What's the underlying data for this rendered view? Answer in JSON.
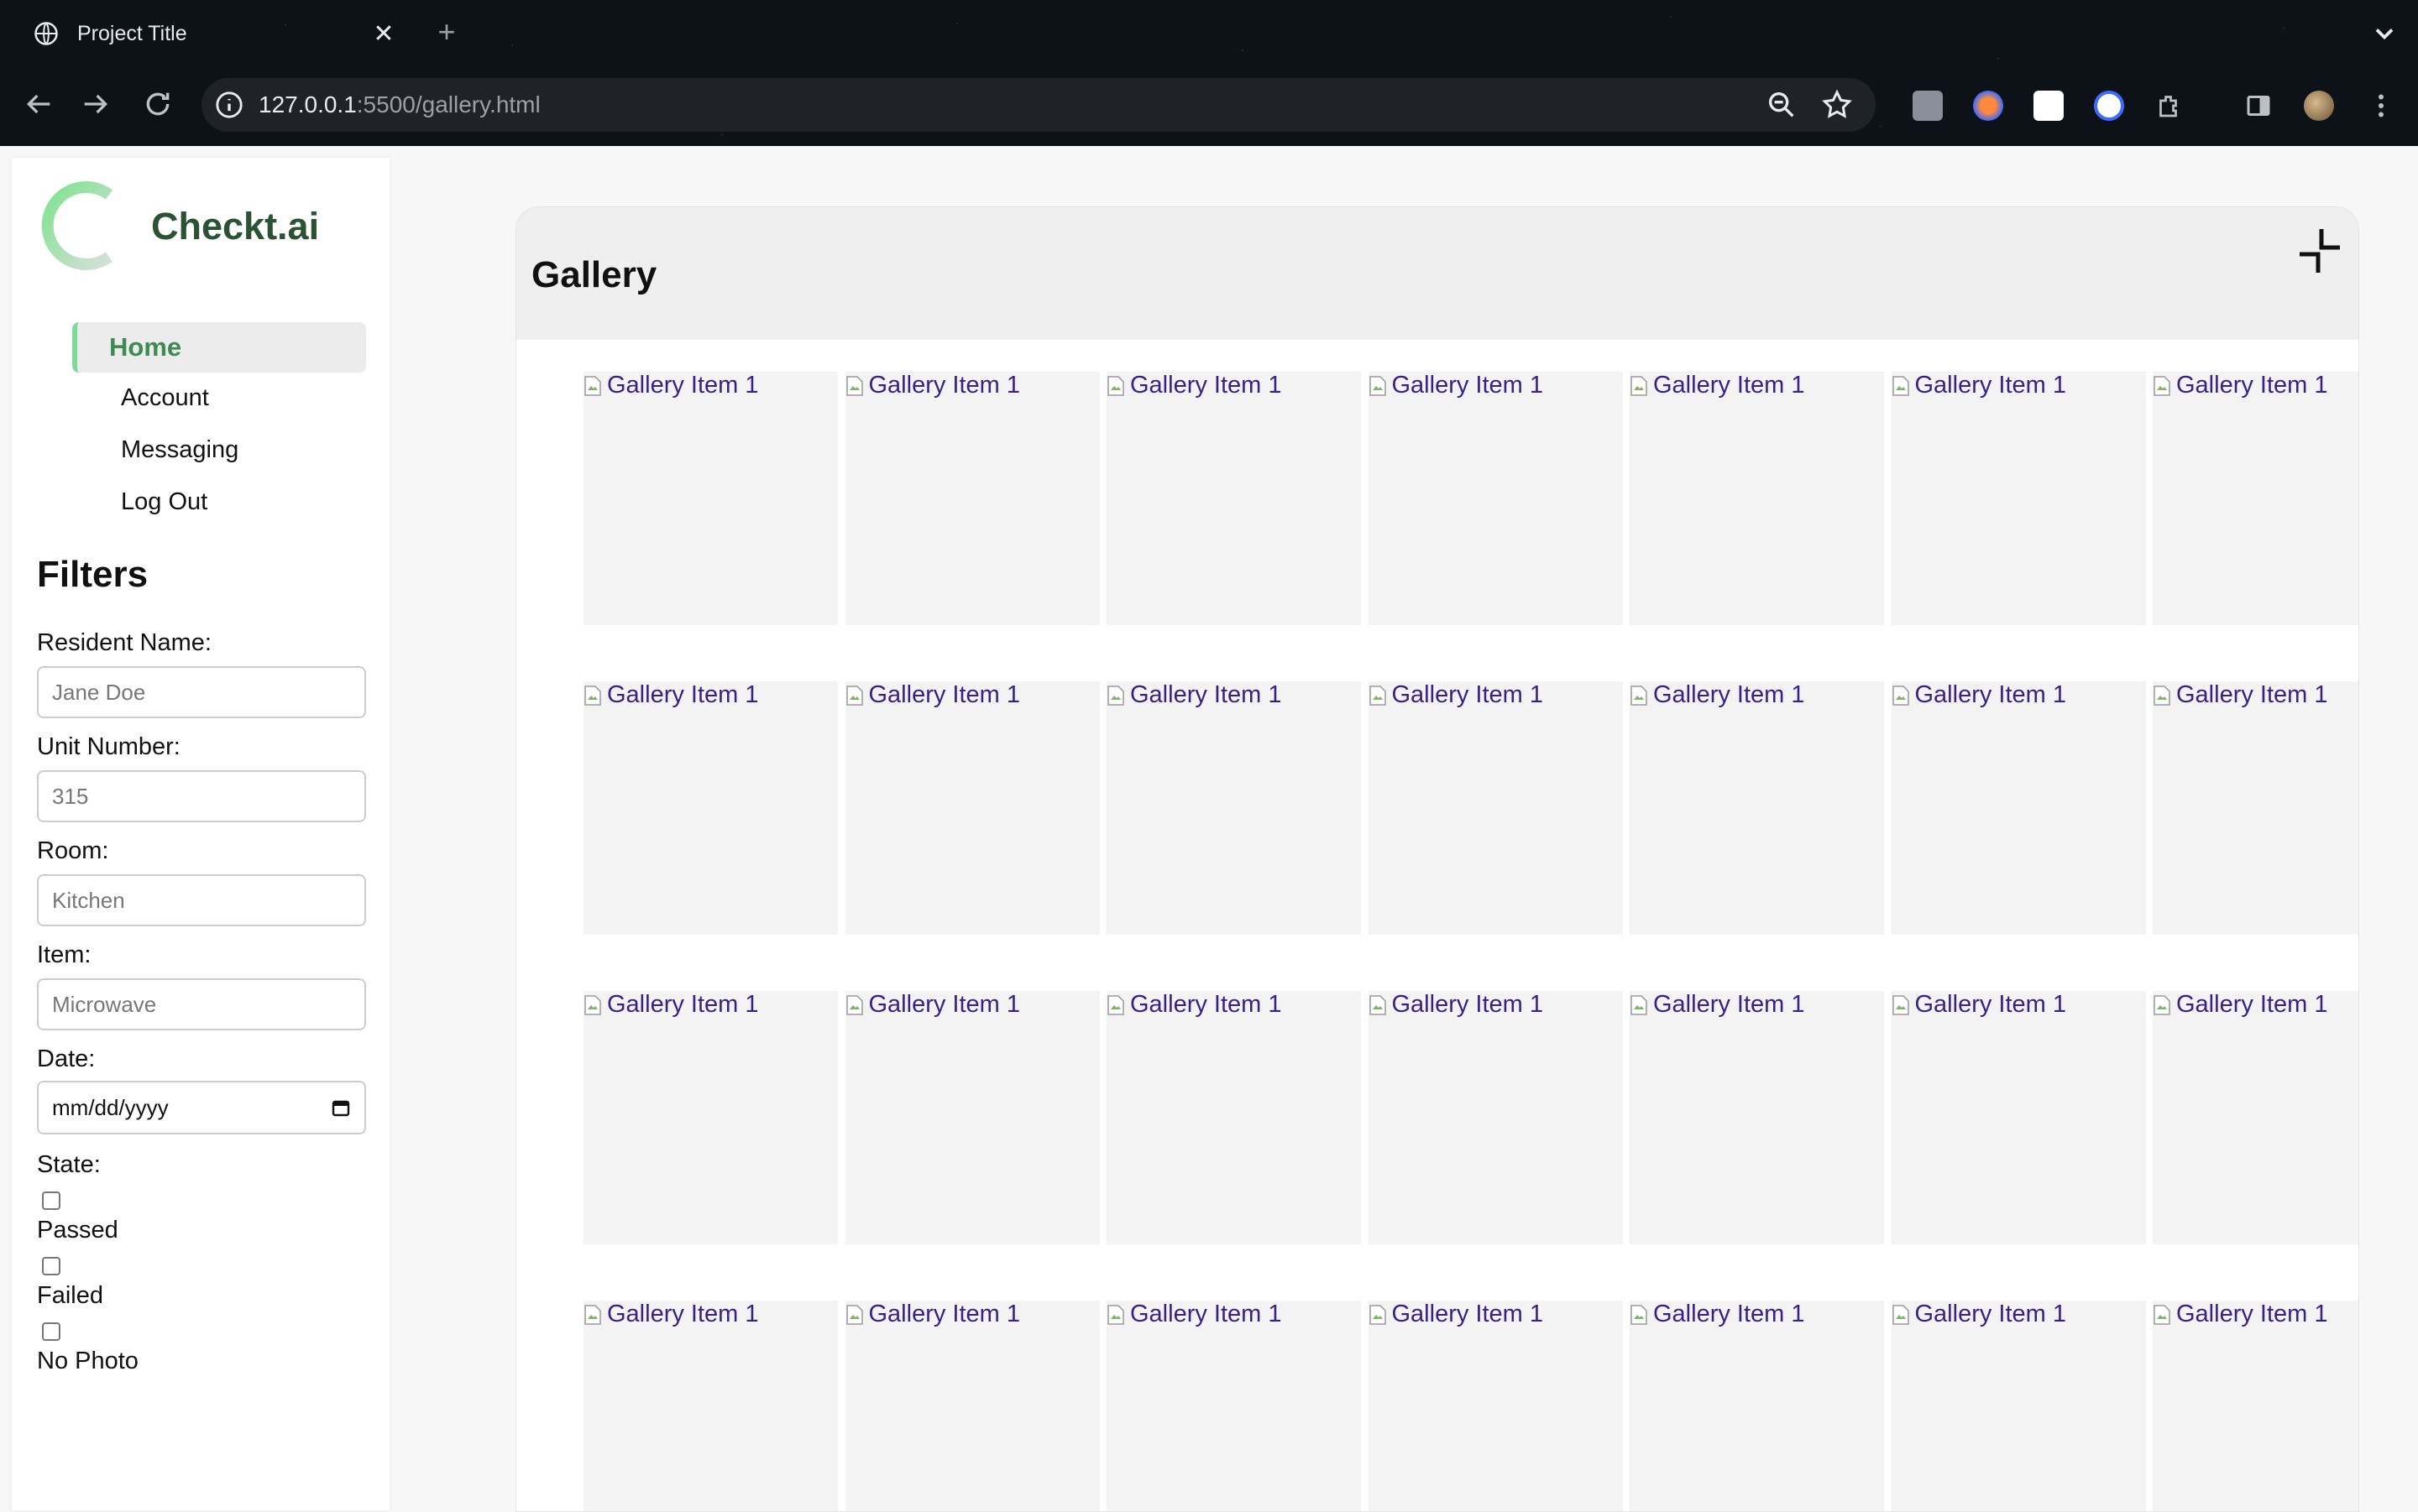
{
  "browser": {
    "tab_title": "Project Title",
    "close_glyph": "✕",
    "newtab_glyph": "+",
    "url_host": "127.0.0.1",
    "url_rest": ":5500/gallery.html"
  },
  "sidebar": {
    "brand": "Checkt.ai",
    "nav": {
      "home": "Home",
      "account": "Account",
      "messaging": "Messaging",
      "logout": "Log Out"
    },
    "filters_title": "Filters",
    "fields": {
      "resident_label": "Resident Name:",
      "resident_placeholder": "Jane Doe",
      "unit_label": "Unit Number:",
      "unit_placeholder": "315",
      "room_label": "Room:",
      "room_placeholder": "Kitchen",
      "item_label": "Item:",
      "item_placeholder": "Microwave",
      "date_label": "Date:",
      "date_value": "mm/dd/yyyy"
    },
    "state_label": "State:",
    "states": [
      "Passed",
      "Failed",
      "No Photo"
    ]
  },
  "gallery": {
    "title": "Gallery",
    "item_alt": "Gallery Item 1",
    "rows": 4,
    "cols": 7
  },
  "colors": {
    "brand": "#2c5234",
    "accent": "#7fd99a",
    "link": "#3a1f86"
  },
  "icons": [
    "globe-icon",
    "back-icon",
    "forward-icon",
    "reload-icon",
    "info-icon",
    "zoom-icon",
    "star-icon",
    "extensions-icon",
    "sidepanel-icon",
    "avatar",
    "menu-icon",
    "calendar-icon",
    "collapse-icon",
    "broken-image-icon"
  ]
}
